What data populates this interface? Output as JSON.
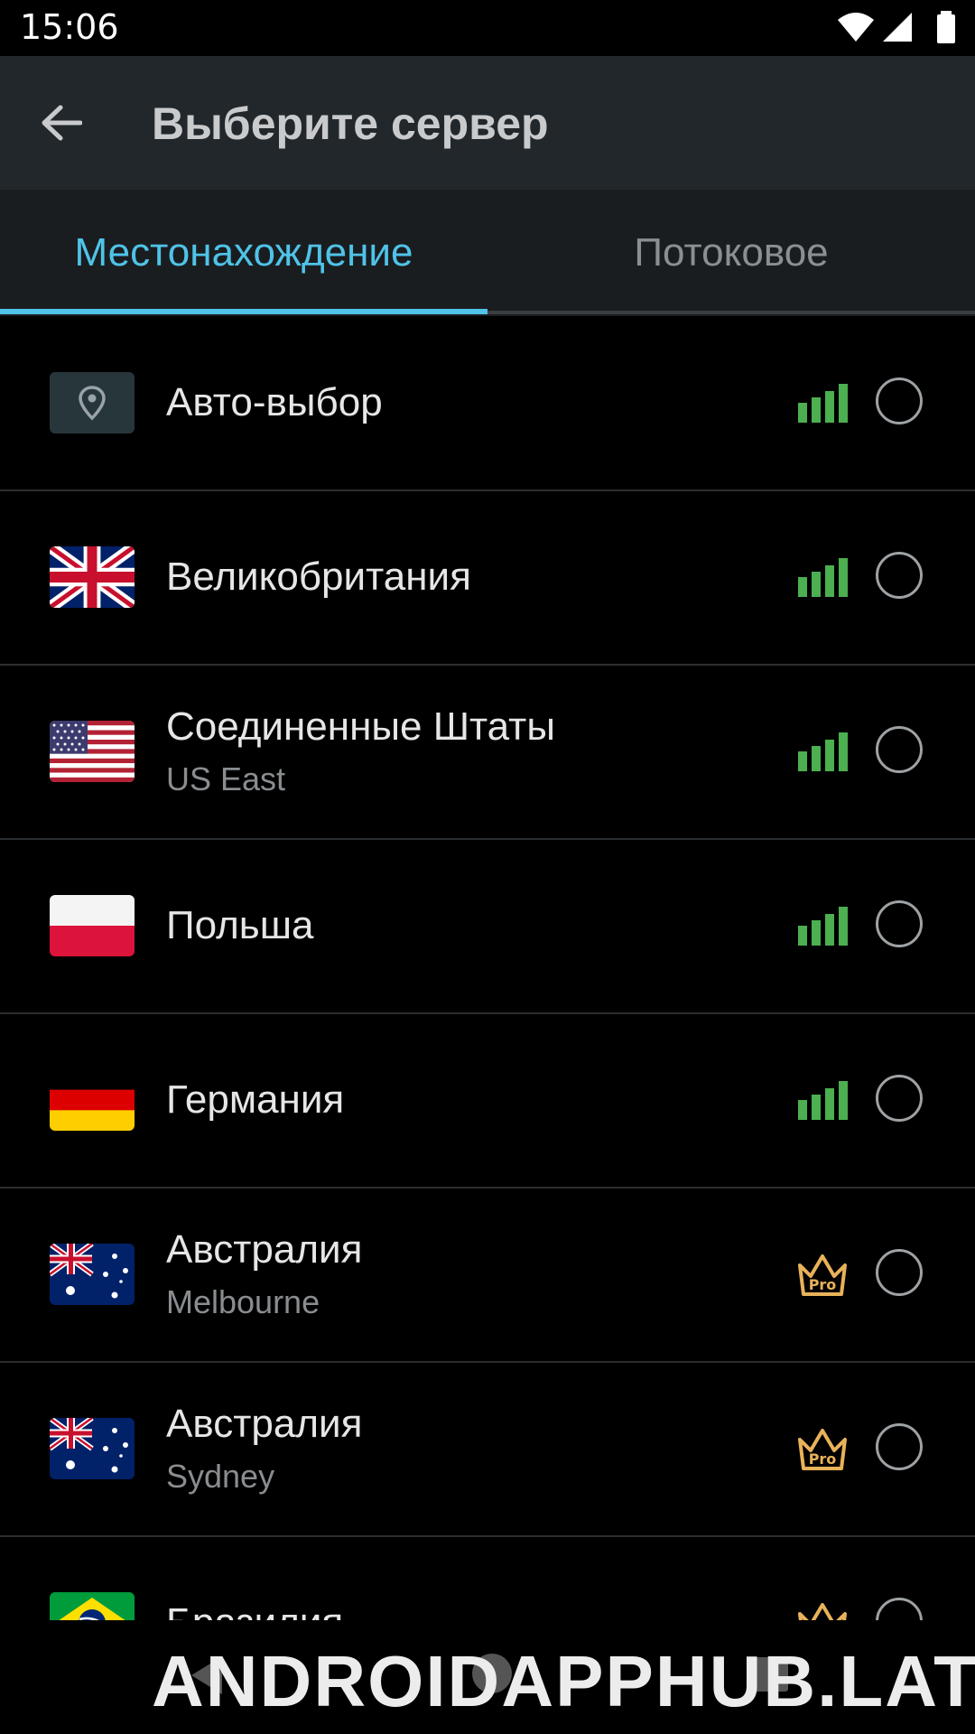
{
  "status_bar": {
    "time": "15:06"
  },
  "app_bar": {
    "title": "Выберите сервер"
  },
  "tabs": [
    {
      "label": "Местонахождение",
      "active": true
    },
    {
      "label": "Потоковое",
      "active": false
    }
  ],
  "colors": {
    "accent": "#4fc3e8",
    "signal_green": "#4caf50",
    "pro_gold": "#e8b25a",
    "app_bar_bg": "#22272b",
    "tab_bar_bg": "#1a1d20"
  },
  "servers": [
    {
      "name": "Авто-выбор",
      "sub": "",
      "icon": "location-pin-icon",
      "tier": "signal",
      "selected": false
    },
    {
      "name": "Великобритания",
      "sub": "",
      "icon": "uk-flag-icon",
      "tier": "signal",
      "selected": false
    },
    {
      "name": "Соединенные Штаты",
      "sub": "US East",
      "icon": "us-flag-icon",
      "tier": "signal",
      "selected": false
    },
    {
      "name": "Польша",
      "sub": "",
      "icon": "poland-flag-icon",
      "tier": "signal",
      "selected": false
    },
    {
      "name": "Германия",
      "sub": "",
      "icon": "germany-flag-icon",
      "tier": "signal",
      "selected": false
    },
    {
      "name": "Австралия",
      "sub": "Melbourne",
      "icon": "australia-flag-icon",
      "tier": "pro",
      "selected": false
    },
    {
      "name": "Австралия",
      "sub": "Sydney",
      "icon": "australia-flag-icon",
      "tier": "pro",
      "selected": false
    },
    {
      "name": "Бразилия",
      "sub": "",
      "icon": "brazil-flag-icon",
      "tier": "pro",
      "selected": false
    }
  ],
  "pro_badge_label": "Pro",
  "watermark": "ANDROIDAPPHUB.LAT"
}
